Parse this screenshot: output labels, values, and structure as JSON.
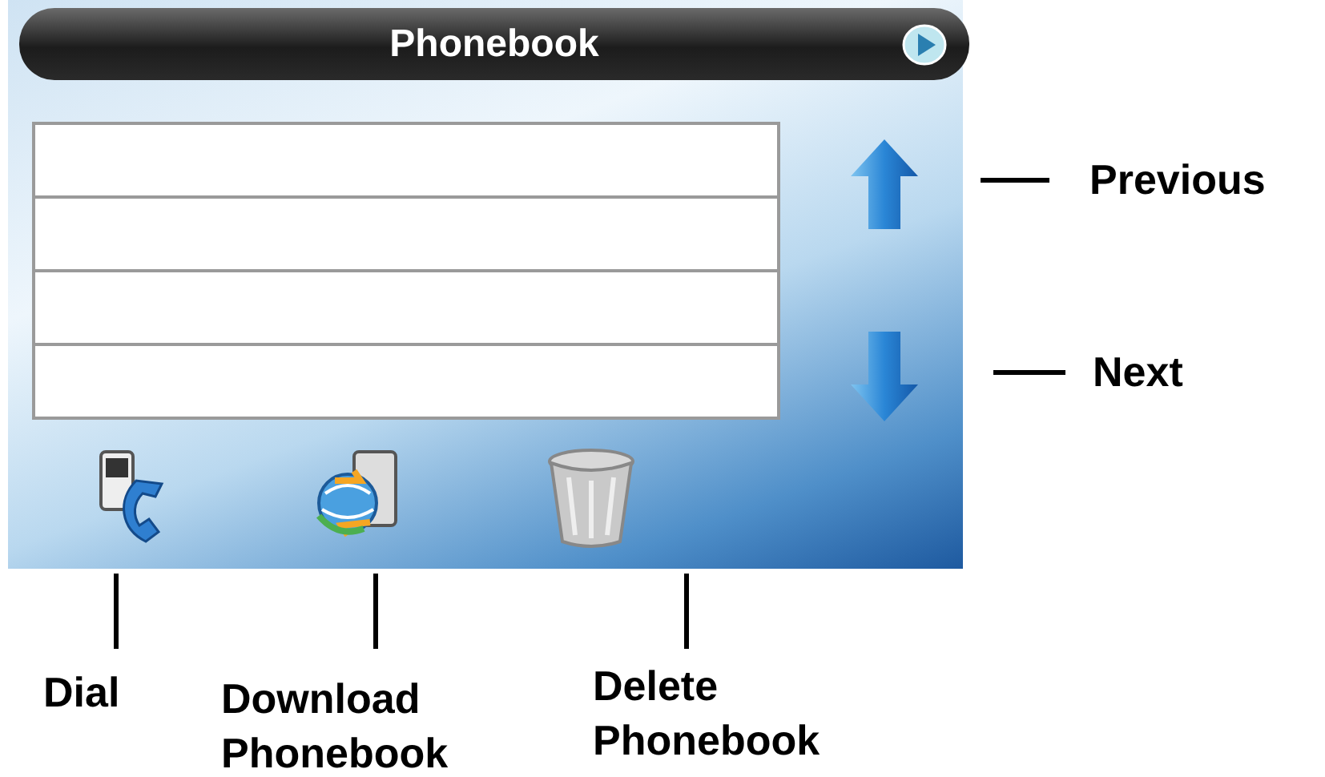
{
  "screen": {
    "title": "Phonebook"
  },
  "side_callouts": [
    {
      "label": "Previous"
    },
    {
      "label": "Next"
    }
  ],
  "bottom_callouts": [
    {
      "label": "Dial"
    },
    {
      "label": "Download Phonebook"
    },
    {
      "label": "Delete Phonebook"
    }
  ]
}
